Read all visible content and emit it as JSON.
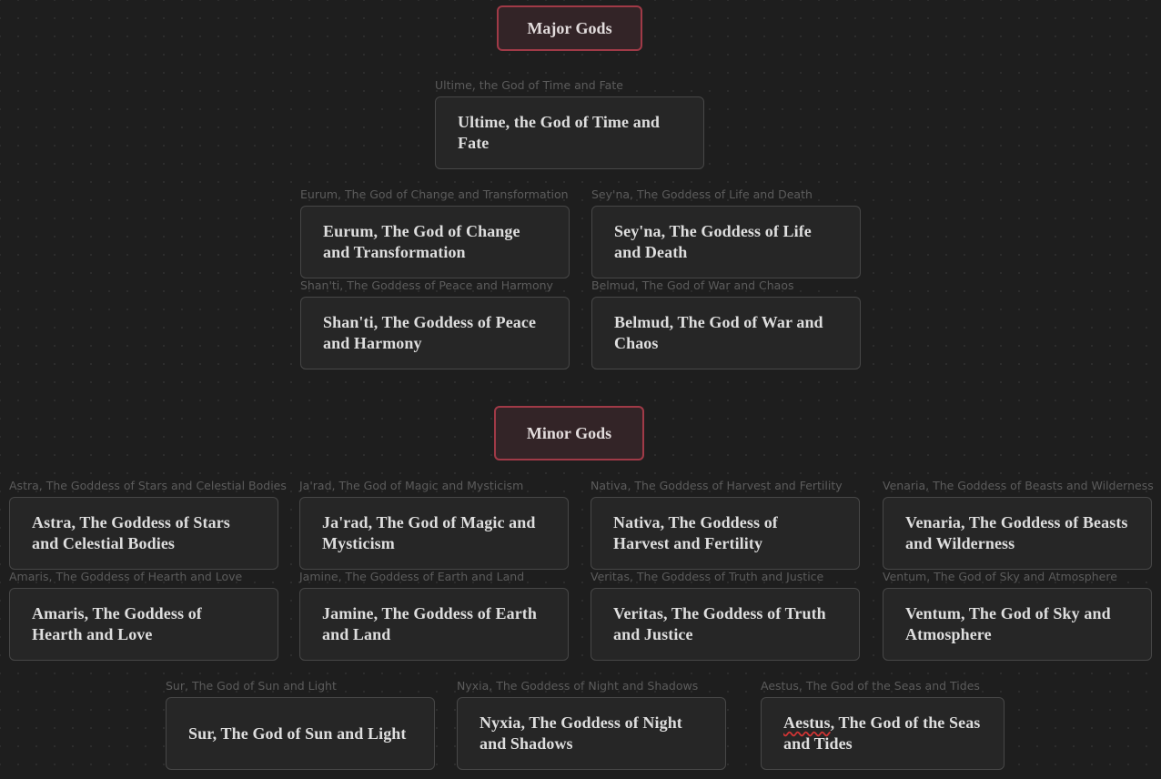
{
  "groups": {
    "major": {
      "label": "Major Gods"
    },
    "minor": {
      "label": "Minor Gods"
    }
  },
  "nodes": {
    "ultime": {
      "label": "Ultime, the God of Time and Fate",
      "title": "Ultime, the God of Time and Fate"
    },
    "eurum": {
      "label": "Eurum, The God of Change and Transformation",
      "title": "Eurum, The God of Change and Transformation"
    },
    "seyna": {
      "label": "Sey'na, The Goddess of Life and Death",
      "title": "Sey'na, The Goddess of Life and Death"
    },
    "shanti": {
      "label": "Shan'ti, The Goddess of Peace and Harmony",
      "title": "Shan'ti, The Goddess of Peace and Harmony"
    },
    "belmud": {
      "label": "Belmud, The God of War and Chaos",
      "title": "Belmud, The God of War and Chaos"
    },
    "astra": {
      "label": "Astra, The Goddess of Stars and Celestial Bodies",
      "title": "Astra, The Goddess of Stars and Celestial Bodies"
    },
    "jarad": {
      "label": "Ja'rad, The God of Magic and Mysticism",
      "title": "Ja'rad, The God of Magic and Mysticism"
    },
    "nativa": {
      "label": "Nativa, The Goddess of Harvest and Fertility",
      "title": "Nativa, The Goddess of Harvest and Fertility"
    },
    "venaria": {
      "label": "Venaria, The Goddess of Beasts and Wilderness",
      "title": "Venaria, The Goddess of Beasts and Wilderness"
    },
    "amaris": {
      "label": "Amaris, The Goddess of Hearth and Love",
      "title": "Amaris, The Goddess of Hearth and Love"
    },
    "jamine": {
      "label": "Jamine, The Goddess of Earth and Land",
      "title": "Jamine, The Goddess of Earth and Land"
    },
    "veritas": {
      "label": "Veritas, The Goddess of Truth and Justice",
      "title": "Veritas, The Goddess of Truth and Justice"
    },
    "ventum": {
      "label": "Ventum, The God of Sky and Atmosphere",
      "title": "Ventum, The God of Sky and Atmosphere"
    },
    "sur": {
      "label": "Sur, The God of Sun and Light",
      "title": "Sur, The God of Sun and Light"
    },
    "nyxia": {
      "label": "Nyxia, The Goddess of Night and Shadows",
      "title": "Nyxia, The Goddess of Night and Shadows"
    },
    "aestus": {
      "label": "Aestus, The God of the Seas and Tides",
      "title_word": "Aestus",
      "title_rest": ", The God of the Seas and Tides"
    }
  },
  "colors": {
    "background": "#1e1e1e",
    "group_border": "#a03a47",
    "group_fill": "#332427",
    "card_fill": "#262626",
    "card_border": "#474747",
    "label_text": "#5c5c5c",
    "spellcheck_underline": "#d23434"
  }
}
